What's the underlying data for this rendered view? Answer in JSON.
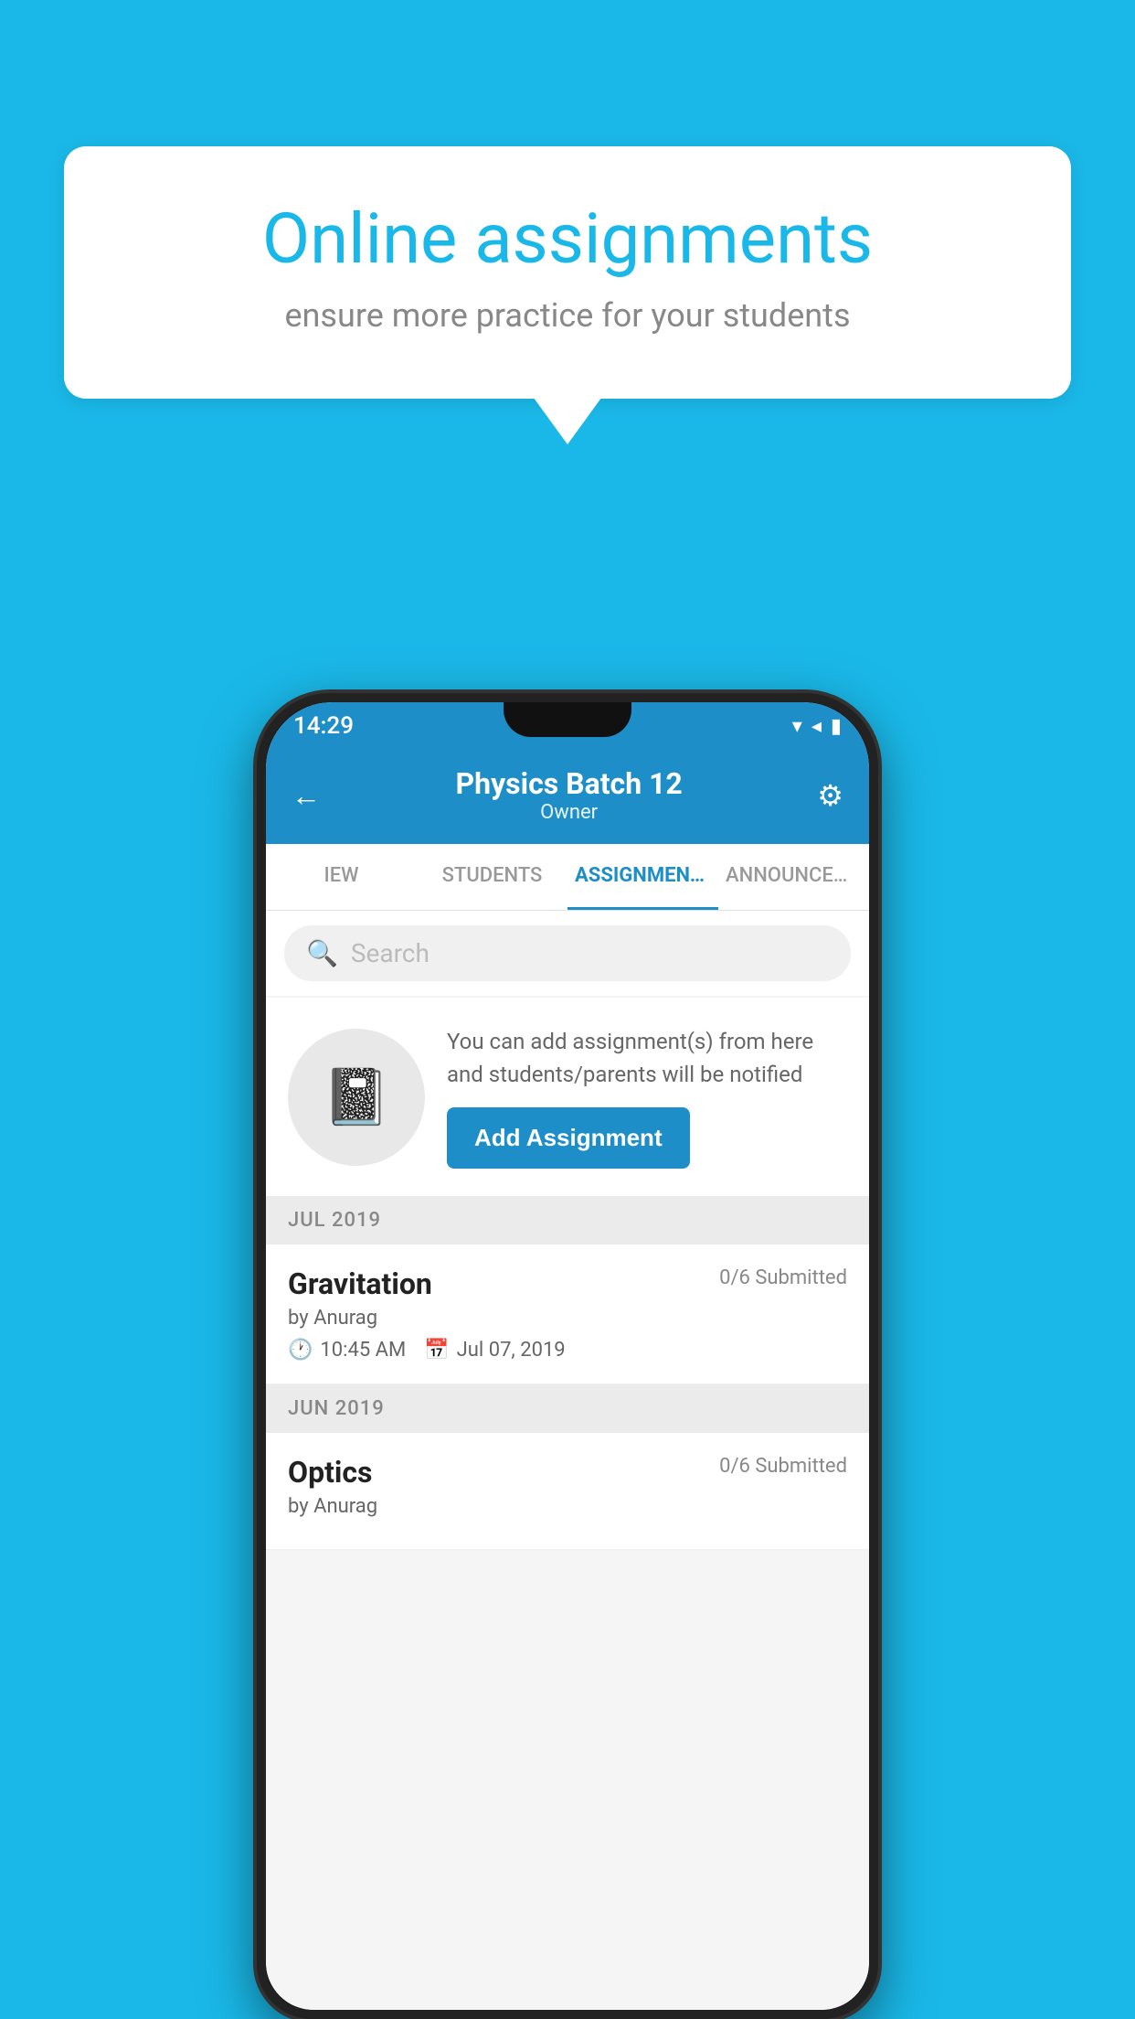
{
  "background_color": "#1ab8e8",
  "speech_bubble": {
    "title": "Online assignments",
    "subtitle": "ensure more practice for your students"
  },
  "status_bar": {
    "time": "14:29",
    "icons": [
      "▾",
      "◂",
      "▮"
    ]
  },
  "header": {
    "title": "Physics Batch 12",
    "subtitle": "Owner",
    "back_label": "←",
    "gear_label": "⚙"
  },
  "tabs": [
    {
      "label": "IEW",
      "active": false
    },
    {
      "label": "STUDENTS",
      "active": false
    },
    {
      "label": "ASSIGNMENTS",
      "active": true
    },
    {
      "label": "ANNOUNCEM...",
      "active": false
    }
  ],
  "search": {
    "placeholder": "Search"
  },
  "add_section": {
    "description": "You can add assignment(s) from here and students/parents will be notified",
    "button_label": "Add Assignment"
  },
  "month_sections": [
    {
      "label": "JUL 2019",
      "assignments": [
        {
          "name": "Gravitation",
          "submitted": "0/6 Submitted",
          "by": "by Anurag",
          "time": "10:45 AM",
          "date": "Jul 07, 2019"
        }
      ]
    },
    {
      "label": "JUN 2019",
      "assignments": [
        {
          "name": "Optics",
          "submitted": "0/6 Submitted",
          "by": "by Anurag",
          "time": "",
          "date": ""
        }
      ]
    }
  ]
}
